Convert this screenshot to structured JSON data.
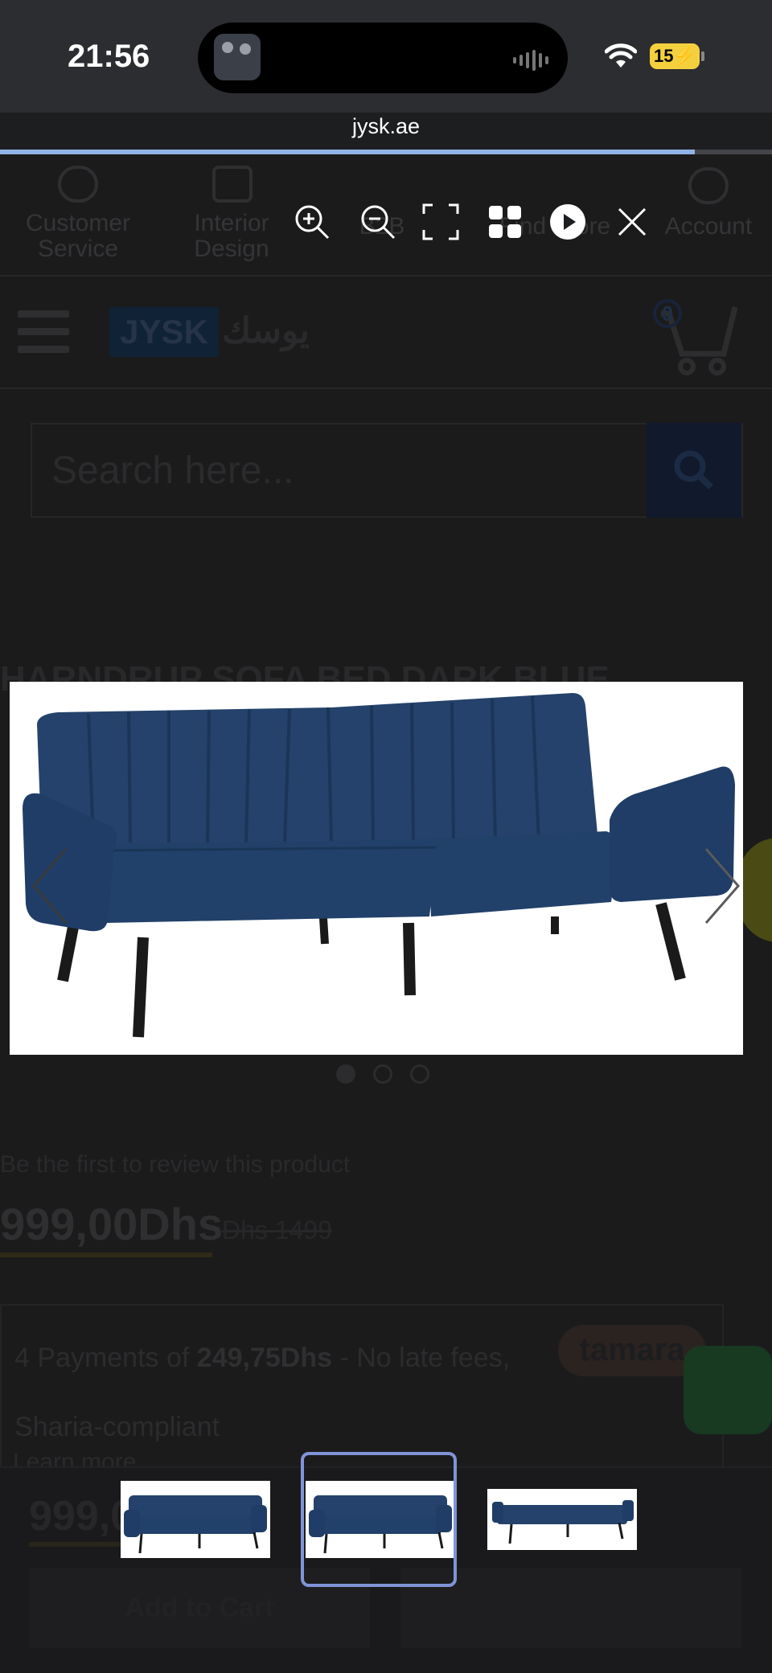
{
  "status_bar": {
    "time": "21:56",
    "battery": "15",
    "battery_icon": "charging-battery-icon",
    "wifi_icon": "wifi-icon"
  },
  "browser": {
    "url": "jysk.ae",
    "load_progress": 0.9
  },
  "site": {
    "top_nav": [
      {
        "label": "Customer Service",
        "icon": "headset-icon"
      },
      {
        "label": "Interior Design",
        "icon": "sofa-icon"
      },
      {
        "label": "B2B",
        "icon": "handshake-icon"
      },
      {
        "label": "Find Store",
        "icon": "location-pin-icon"
      },
      {
        "label": "Account",
        "icon": "user-icon"
      }
    ],
    "logo": {
      "latin": "JYSK",
      "arabic": "يوسك"
    },
    "cart_count": "0",
    "search_placeholder": "Search here...",
    "product_title": "HARNDRUP SOFA BED DARK BLUE",
    "review_text": "Be the first to review this product",
    "price": "999,00Dhs",
    "old_price": "Dhs 1499",
    "installments": {
      "prefix": "4 Payments of",
      "amount": "249,75Dhs",
      "suffix": "- No late fees,",
      "line2": "Sharia-compliant",
      "brand": "tamara",
      "learn_more": "Learn more"
    },
    "sticky_price": "999,00",
    "add_to_cart": "Add to Cart"
  },
  "lightbox": {
    "toolbar": [
      {
        "name": "zoom-in-icon"
      },
      {
        "name": "zoom-out-icon"
      },
      {
        "name": "fullscreen-icon"
      },
      {
        "name": "gallery-grid-icon"
      },
      {
        "name": "slideshow-play-icon"
      },
      {
        "name": "close-icon"
      }
    ],
    "image_count": 3,
    "active_index": 1,
    "prev_icon": "chevron-left-icon",
    "next_icon": "chevron-right-icon"
  },
  "colors": {
    "sofa": "#1f3a5f",
    "thumb_selected_border": "#8094d6",
    "progress": "#8fb3e6",
    "battery": "#f4d03f"
  }
}
